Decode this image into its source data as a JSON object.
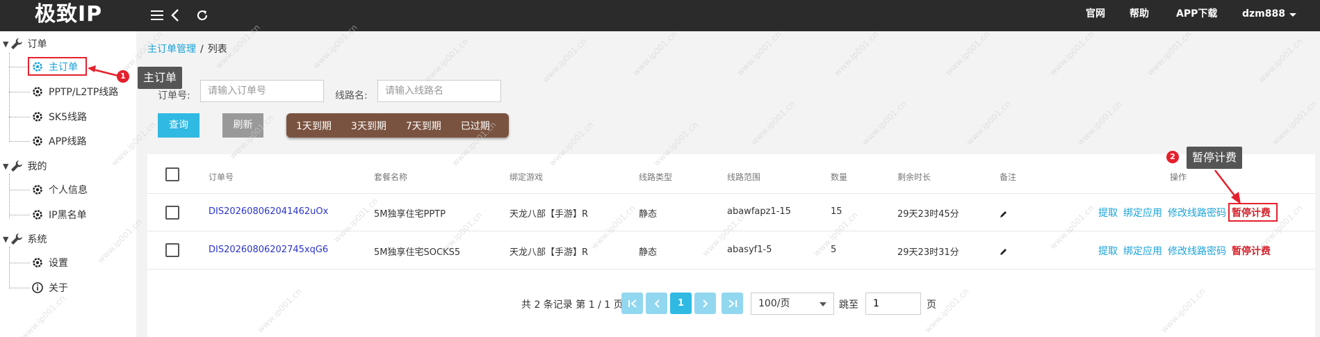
{
  "app": {
    "brand": "极致IP"
  },
  "topnav": {
    "site": "官网",
    "help": "帮助",
    "app_download": "APP下载",
    "user": "dzm888"
  },
  "sidebar": {
    "groups": [
      {
        "label": "订单",
        "items": [
          {
            "label": "主订单"
          },
          {
            "label": "PPTP/L2TP线路"
          },
          {
            "label": "SK5线路"
          },
          {
            "label": "APP线路"
          }
        ]
      },
      {
        "label": "我的",
        "items": [
          {
            "label": "个人信息"
          },
          {
            "label": "IP黑名单"
          }
        ]
      },
      {
        "label": "系统",
        "items": [
          {
            "label": "设置"
          },
          {
            "label": "关于"
          }
        ]
      }
    ]
  },
  "annotations": {
    "one": {
      "num": "1",
      "text": "主订单"
    },
    "two": {
      "num": "2",
      "text": "暂停计费"
    }
  },
  "breadcrumb": {
    "parent": "主订单管理",
    "sep": "/",
    "current": "列表"
  },
  "filters": {
    "order_label": "订单号:",
    "order_placeholder": "请输入订单号",
    "line_label": "线路名:",
    "line_placeholder": "请输入线路名",
    "query": "查询",
    "refresh": "刷新",
    "expire": [
      "1天到期",
      "3天到期",
      "7天到期",
      "已过期"
    ]
  },
  "table": {
    "headers": [
      "订单号",
      "套餐名称",
      "绑定游戏",
      "线路类型",
      "线路范围",
      "数量",
      "剩余时长",
      "备注",
      "操作"
    ],
    "rows": [
      {
        "order": "DIS202608062041462uOx",
        "package": "5M独享住宅PPTP",
        "game": "天龙八部【手游】R",
        "type": "静态",
        "range": "abawfapz1-15",
        "qty": "15",
        "remain": "29天23时45分"
      },
      {
        "order": "DIS20260806202745xqG6",
        "package": "5M独享住宅SOCKS5",
        "game": "天龙八部【手游】R",
        "type": "静态",
        "range": "abasyf1-5",
        "qty": "5",
        "remain": "29天23时31分"
      }
    ],
    "ops": {
      "extract": "提取",
      "bind": "绑定应用",
      "modify": "修改线路密码",
      "pause": "暂停计费"
    }
  },
  "pagination": {
    "summary": "共 2 条记录 第 1 / 1 页",
    "current": "1",
    "page_size": "100/页",
    "jump_label": "跳至",
    "jump_value": "1",
    "page_suffix": "页"
  },
  "watermark": "www.ip001.cn",
  "colors": {
    "accent": "#2fb9e3",
    "topbar": "#2b2b2b",
    "annotation": "#e5202c",
    "expire_group": "#7a5340"
  }
}
